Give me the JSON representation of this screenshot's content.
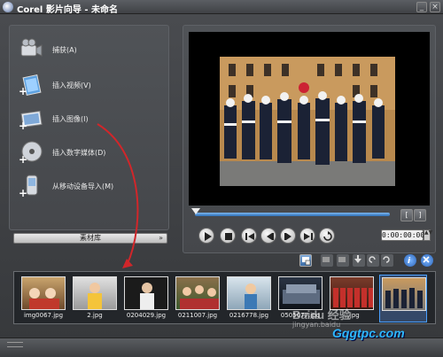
{
  "window": {
    "title": "Corel 影片向导 - 未命名"
  },
  "capture_menu": [
    {
      "label": "捕获(A)",
      "icon": "camcorder-icon"
    },
    {
      "label": "插入视频(V)",
      "icon": "insert-video-icon"
    },
    {
      "label": "插入图像(I)",
      "icon": "insert-image-icon"
    },
    {
      "label": "插入数字媒体(D)",
      "icon": "insert-disc-icon"
    },
    {
      "label": "从移动设备导入(M)",
      "icon": "mobile-device-icon"
    }
  ],
  "library": {
    "label": "素材库",
    "chevron": "»"
  },
  "player": {
    "mark_in": "[",
    "mark_out": "]",
    "timecode": "0:00:00:00",
    "timecode_spin": "▲▼"
  },
  "filmstrip": [
    {
      "caption": "img0067.jpg"
    },
    {
      "caption": "2.jpg"
    },
    {
      "caption": "0204029.jpg"
    },
    {
      "caption": "0211007.jpg"
    },
    {
      "caption": "0216778.jpg"
    },
    {
      "caption": "0505077.jpg"
    },
    {
      "caption": "...jpg"
    },
    {
      "caption": ""
    }
  ],
  "watermarks": {
    "baidu": "Baidu 经验",
    "baidu_sub": "jingyan.baidu",
    "site": "Gqgtpc.com"
  },
  "colors": {
    "accent": "#2c6fb8",
    "annotation_arrow": "#d1262a",
    "selection": "#4aa0ff"
  }
}
